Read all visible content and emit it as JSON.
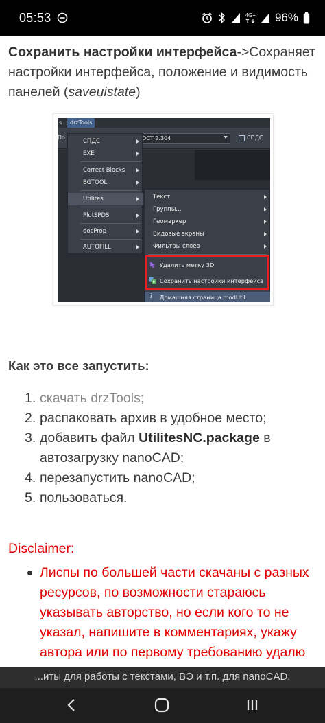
{
  "status_bar": {
    "time": "05:53",
    "network": "4G+",
    "battery": "96%"
  },
  "article": {
    "para1_bold": "Сохранить настройки интерфейса",
    "para1_rest": "->Сохраняет настройки интерфейса, положение и видимость панелей (",
    "para1_italic": "saveuistate",
    "para1_close": ")"
  },
  "cad_screenshot": {
    "menu_left_label": "s",
    "menu_active": "drzTools",
    "toolbar_left": "По",
    "dropdown_value": "ОСТ 2.304",
    "toolbar_right": "СПДС",
    "menu1": [
      "СПДС",
      "EXE",
      "Correct Blocks",
      "BGTOOL",
      "Utilites",
      "PlotSPDS",
      "docProp",
      "AUTOFILL"
    ],
    "menu2": [
      "Текст",
      "Группы...",
      "Геомаркер",
      "Видовые экраны",
      "Фильтры слоев"
    ],
    "cmd_delete": "Удалить метку 3D",
    "cmd_save": "Сохранить настройки интерфейса",
    "cmd_home": "Домашняя страница modUtil",
    "home_icon": "i"
  },
  "howto": {
    "heading": "Как это все запустить:",
    "steps": [
      {
        "num": "1.",
        "text": "скачать drzTools;"
      },
      {
        "num": "2.",
        "text": "распаковать архив в удобное место;"
      },
      {
        "num": "3.",
        "pre": "добавить файл ",
        "bold": "UtilitesNC.package",
        "post": " в автозагрузку nanoCAD;"
      },
      {
        "num": "4.",
        "text": "перезапустить nanoCAD;"
      },
      {
        "num": "5.",
        "text": "пользоваться."
      }
    ]
  },
  "disclaimer": {
    "heading": "Disclaimer:",
    "item1": "Лиспы по большей части скачаны с разных ресурсов, по возможности стараюсь указывать авторство, но если кого то не указал, напишите в комментариях, укажу автора или по первому требованию удалю лисп из"
  },
  "caption": "...иты для работы с текстами, ВЭ и т.п. для nanoCAD.",
  "colors": {
    "disclaimer_red": "#e00000",
    "highlight_frame": "#e8201d",
    "cad_dark": "#353a42"
  }
}
